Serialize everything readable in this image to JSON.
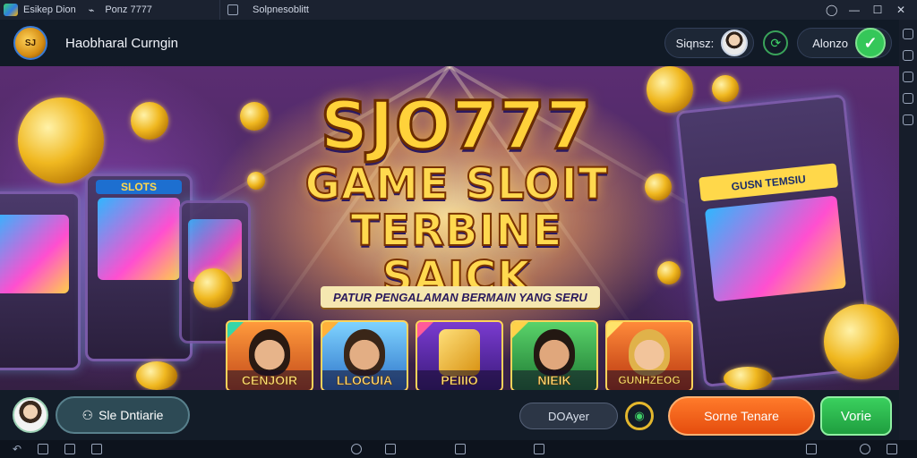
{
  "titlebar": {
    "app_name": "Esikep Dion",
    "tab1": "Ponz 7777",
    "tab2": "Solpnesoblitt",
    "icons": [
      "app-logo-icon",
      "tab-box-icon",
      "notification-icon",
      "minimize-icon",
      "maximize-icon",
      "close-icon"
    ]
  },
  "header": {
    "logo_text": "SJ",
    "title": "Haobharal Curngin",
    "sign_label": "Siqnsz:",
    "account_label": "Alonzo"
  },
  "banner": {
    "brand": "SJO777",
    "headline_line1": "GAME SLOIT",
    "headline_line2": "TERBINE SAICK",
    "tagline": "PATUR PENGALAMAN BERMAIN YANG SERU",
    "left_machine_label": "SLOTS",
    "right_machine_label": "GUSN TEMSIU",
    "cards": [
      {
        "label": "CENJOIR"
      },
      {
        "label": "LLOCUIA"
      },
      {
        "label": "PEIIIO"
      },
      {
        "label": "NIEIK"
      },
      {
        "label": "GUNHZEOG"
      }
    ]
  },
  "bottombar": {
    "left_button": "Sle Dntiarie",
    "field_value": "DOAyer",
    "orange_button": "Sorne Tenare",
    "green_button": "Vorie"
  },
  "colors": {
    "accent_green": "#35c759",
    "accent_orange": "#ff7a2a",
    "gold": "#ffd23a",
    "banner_purple": "#5b2d72"
  }
}
